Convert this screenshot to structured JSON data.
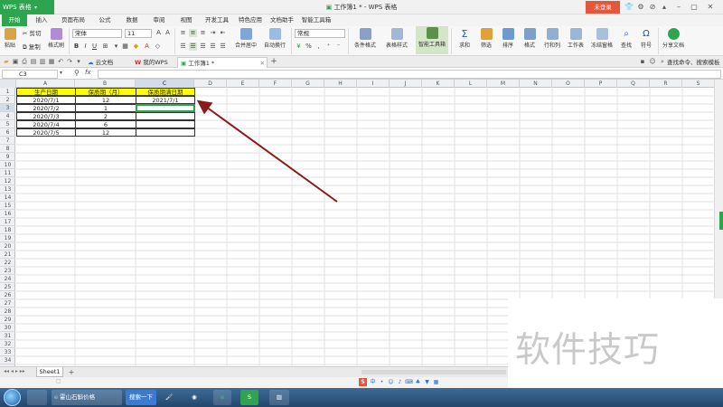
{
  "app": {
    "brand": "WPS 表格",
    "window_title": "工作簿1 * - WPS 表格",
    "login_label": "未登录"
  },
  "menu": {
    "tabs": [
      "开始",
      "插入",
      "页面布局",
      "公式",
      "数据",
      "审阅",
      "视图",
      "开发工具",
      "特色应用",
      "文档助手",
      "智能工具箱"
    ],
    "active": "开始"
  },
  "ribbon": {
    "paste": "粘贴",
    "cut": "剪切",
    "copy": "复制",
    "format_painter": "格式刷",
    "font_name": "宋体",
    "font_size": "11",
    "merge_center": "合并居中",
    "wrap_text": "自动换行",
    "number_format": "常规",
    "conditional_format": "条件格式",
    "table_style": "表格样式",
    "smart_toolbox": "智能工具箱",
    "sum": "求和",
    "filter": "筛选",
    "sort": "排序",
    "format": "格式",
    "row_col": "行和列",
    "worksheet": "工作表",
    "freeze": "冻结窗格",
    "find": "查找",
    "symbol": "符号",
    "share": "分享文档"
  },
  "tabs": {
    "cloud": "云文档",
    "mywps": "我的WPS",
    "workbook": "工作簿1 *",
    "search_cmd": "查找命令、搜索模板"
  },
  "formula_bar": {
    "cell_ref": "C3",
    "fx": "fx",
    "value": ""
  },
  "grid": {
    "columns": [
      "A",
      "B",
      "C",
      "D",
      "E",
      "F",
      "G",
      "H",
      "I",
      "J",
      "K",
      "L",
      "M",
      "N",
      "O",
      "P",
      "Q",
      "R",
      "S"
    ],
    "rows": [
      "1",
      "2",
      "3",
      "4",
      "5",
      "6",
      "7",
      "8",
      "9",
      "10",
      "11",
      "12",
      "13",
      "14",
      "15",
      "16",
      "17",
      "18",
      "19",
      "20",
      "21",
      "22",
      "23",
      "24",
      "25",
      "26",
      "27",
      "28",
      "29",
      "30",
      "31",
      "32",
      "33",
      "34"
    ],
    "headers": [
      "生产日期",
      "保质期（月）",
      "保质期满日期"
    ],
    "data": [
      [
        "2020/7/1",
        "12",
        "2021/7/1"
      ],
      [
        "2020/7/2",
        "1",
        ""
      ],
      [
        "2020/7/3",
        "2",
        ""
      ],
      [
        "2020/7/4",
        "6",
        ""
      ],
      [
        "2020/7/5",
        "12",
        ""
      ]
    ]
  },
  "sheet": {
    "name": "Sheet1"
  },
  "taskbar": {
    "browser_tab": "霍山石斛价格",
    "search_btn": "搜索一下"
  },
  "watermark": "软件技巧",
  "colors": {
    "accent": "#2ea44f",
    "header_fill": "#ffff00",
    "arrow": "#8b1a1a"
  }
}
